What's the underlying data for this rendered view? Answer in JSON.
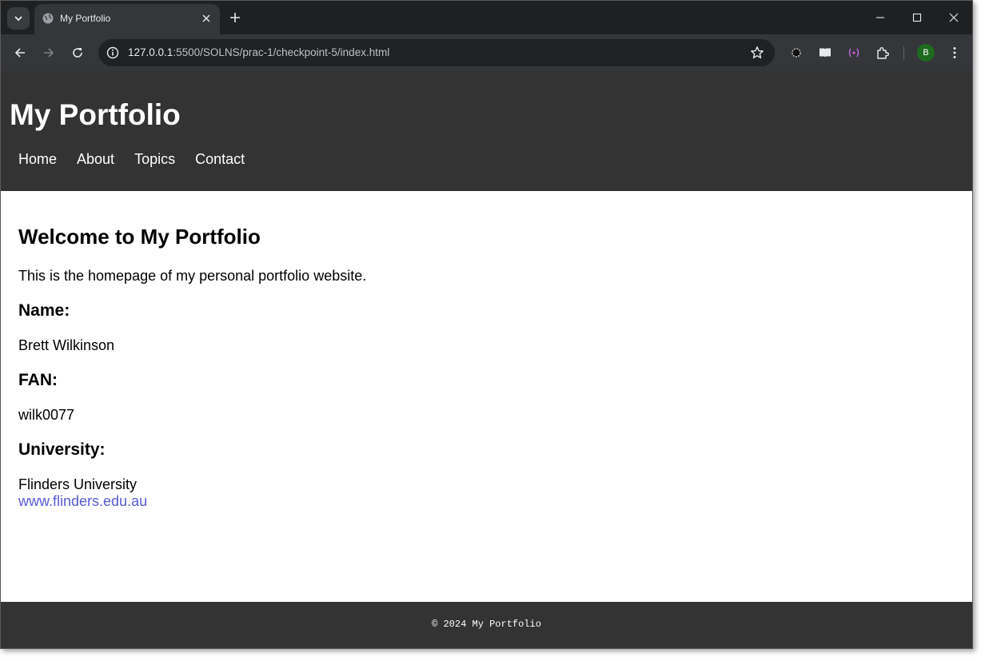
{
  "browser": {
    "tab_title": "My Portfolio",
    "url_host": "127.0.0.1",
    "url_rest": ":5500/SOLNS/prac-1/checkpoint-5/index.html",
    "profile_initial": "B"
  },
  "site": {
    "title": "My Portfolio",
    "nav": [
      "Home",
      "About",
      "Topics",
      "Contact"
    ]
  },
  "main": {
    "heading": "Welcome to My Portfolio",
    "intro": "This is the homepage of my personal portfolio website.",
    "name_label": "Name:",
    "name_value": "Brett Wilkinson",
    "fan_label": "FAN:",
    "fan_value": "wilk0077",
    "university_label": "University:",
    "university_value": "Flinders University",
    "university_link": "www.flinders.edu.au"
  },
  "footer": {
    "text": "© 2024 My Portfolio"
  },
  "colors": {
    "header_bg": "#333333",
    "link": "#5a5ad6",
    "avatar": "#1e6b1e"
  }
}
